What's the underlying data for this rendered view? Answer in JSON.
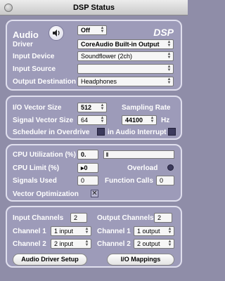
{
  "window": {
    "title": "DSP Status"
  },
  "audio": {
    "title": "Audio",
    "speaker_icon": "speaker-icon",
    "power_value": "Off",
    "logo": "DSP",
    "driver_label": "Driver",
    "driver_value": "CoreAudio Built-in Output",
    "input_device_label": "Input Device",
    "input_device_value": "Soundflower (2ch)",
    "input_source_label": "Input Source",
    "input_source_value": "",
    "output_destination_label": "Output Destination",
    "output_destination_value": "Headphones"
  },
  "vector": {
    "io_vector_label": "I/O Vector Size",
    "io_vector_value": "512",
    "sampling_rate_label": "Sampling Rate",
    "signal_vector_label": "Signal Vector Size",
    "signal_vector_value": "64",
    "sampling_rate_value": "44100",
    "hz_label": "Hz",
    "overdrive_label": "Scheduler in Overdrive",
    "interrupt_label": "in Audio Interrupt"
  },
  "cpu": {
    "utilization_label": "CPU Utilization (%)",
    "utilization_value": "0.",
    "utilization_fraction": 0.0,
    "limit_label": "CPU Limit (%)",
    "limit_value": "0",
    "overload_label": "Overload",
    "signals_used_label": "Signals Used",
    "signals_used_value": "0",
    "function_calls_label": "Function Calls",
    "function_calls_value": "0",
    "vector_opt_label": "Vector Optimization",
    "vector_opt_mark": "✕"
  },
  "channels": {
    "input_channels_label": "Input Channels",
    "input_channels_value": "2",
    "output_channels_label": "Output Channels",
    "output_channels_value": "2",
    "in_ch1_label": "Channel 1",
    "in_ch1_value": "1 input",
    "out_ch1_label": "Channel 1",
    "out_ch1_value": "1 output",
    "in_ch2_label": "Channel 2",
    "in_ch2_value": "2 input",
    "out_ch2_label": "Channel 2",
    "out_ch2_value": "2 output",
    "driver_setup_button": "Audio Driver Setup",
    "io_mappings_button": "I/O Mappings"
  }
}
